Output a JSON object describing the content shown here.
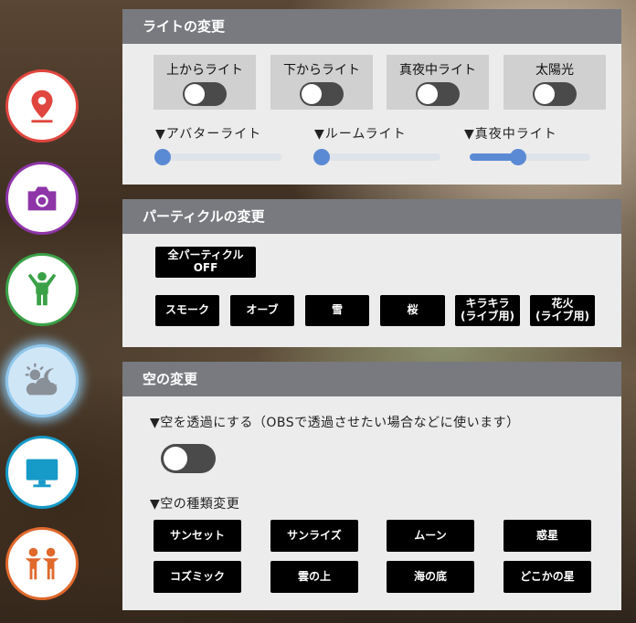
{
  "sidebar": {
    "items": [
      {
        "icon": "map-pin-icon",
        "color": "#e0463f"
      },
      {
        "icon": "camera-icon",
        "color": "#8e35a8"
      },
      {
        "icon": "avatar-icon",
        "color": "#3aa147"
      },
      {
        "icon": "weather-sky-icon",
        "color": "#8fc6ea",
        "active": true
      },
      {
        "icon": "monitor-icon",
        "color": "#169ac8"
      },
      {
        "icon": "people-icon",
        "color": "#e0692c"
      }
    ]
  },
  "light": {
    "title": "ライトの変更",
    "toggles": [
      {
        "label": "上からライト",
        "on": false
      },
      {
        "label": "下からライト",
        "on": false
      },
      {
        "label": "真夜中ライト",
        "on": false
      },
      {
        "label": "太陽光",
        "on": false
      }
    ],
    "sliders": [
      {
        "label": "▼アバターライト",
        "value": 0.0
      },
      {
        "label": "▼ルームライト",
        "value": 0.0
      },
      {
        "label": "▼真夜中ライト",
        "value": 0.4
      }
    ]
  },
  "particle": {
    "title": "パーティクルの変更",
    "all_off": "全パーティクル\nOFF",
    "buttons": [
      "スモーク",
      "オーブ",
      "雪",
      "桜",
      "キラキラ\n(ライブ用)",
      "花火\n(ライブ用)"
    ]
  },
  "sky": {
    "title": "空の変更",
    "transparent_label": "▼空を透過にする（OBSで透過させたい場合などに使います）",
    "transparent_on": false,
    "type_label": "▼空の種類変更",
    "types": [
      "サンセット",
      "サンライズ",
      "ムーン",
      "惑星",
      "コズミック",
      "雲の上",
      "海の底",
      "どこかの星"
    ]
  },
  "colors": {
    "accent": "#5b8ad4",
    "header": "#787a7f",
    "panel": "#ececec"
  }
}
